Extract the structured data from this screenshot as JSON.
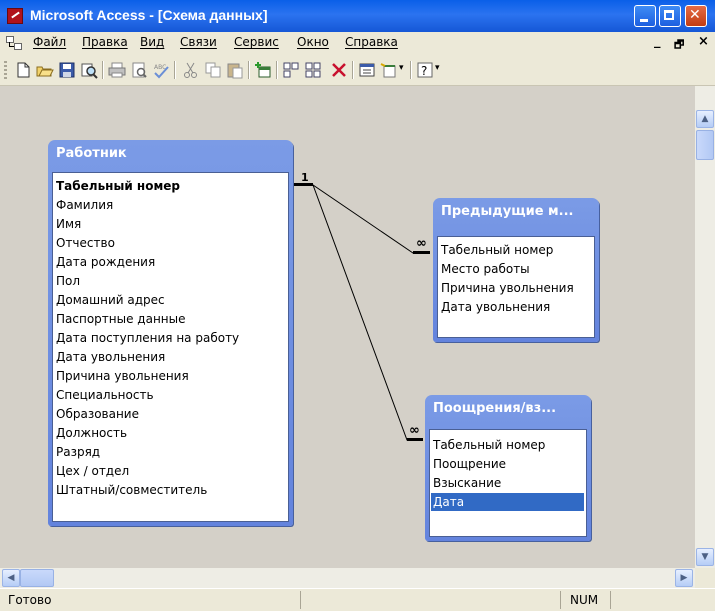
{
  "window": {
    "title": "Microsoft Access - [Схема данных]"
  },
  "menu": [
    "Файл",
    "Правка",
    "Вид",
    "Связи",
    "Сервис",
    "Окно",
    "Справка"
  ],
  "mdi_controls": [
    "_",
    "🗗",
    "×"
  ],
  "toolbar_icons": [
    "new-icon",
    "open-icon",
    "save-icon",
    "search-icon",
    "print-icon",
    "print-preview-icon",
    "spelling-icon",
    "cut-icon",
    "copy-icon",
    "paste-icon",
    "show-table-icon",
    "show-direct-icon",
    "show-all-icon",
    "delete-icon",
    "new-object-icon",
    "office-links-icon",
    "help-icon"
  ],
  "tables": {
    "workers": {
      "title": "Работник",
      "fields": [
        "Табельный номер",
        "Фамилия",
        "Имя",
        "Отчество",
        "Дата рождения",
        "Пол",
        "Домашний адрес",
        "Паспортные данные",
        "Дата поступления на работу",
        "Дата увольнения",
        "Причина увольнения",
        "Специальность",
        "Образование",
        "Должность",
        "Разряд",
        "Цех / отдел",
        "Штатный/совместитель"
      ],
      "key_field": "Табельный номер"
    },
    "previous": {
      "title": "Предыдущие м...",
      "fields": [
        "Табельный номер",
        "Место работы",
        "Причина увольнения",
        "Дата увольнения"
      ]
    },
    "rewards": {
      "title": "Поощрения/вз...",
      "fields": [
        "Табельный номер",
        "Поощрение",
        "Взыскание",
        "Дата"
      ],
      "selected_field": "Дата"
    }
  },
  "relations": {
    "one_mark": "1",
    "many_mark": "∞"
  },
  "status": {
    "text": "Готово",
    "num": "NUM"
  }
}
